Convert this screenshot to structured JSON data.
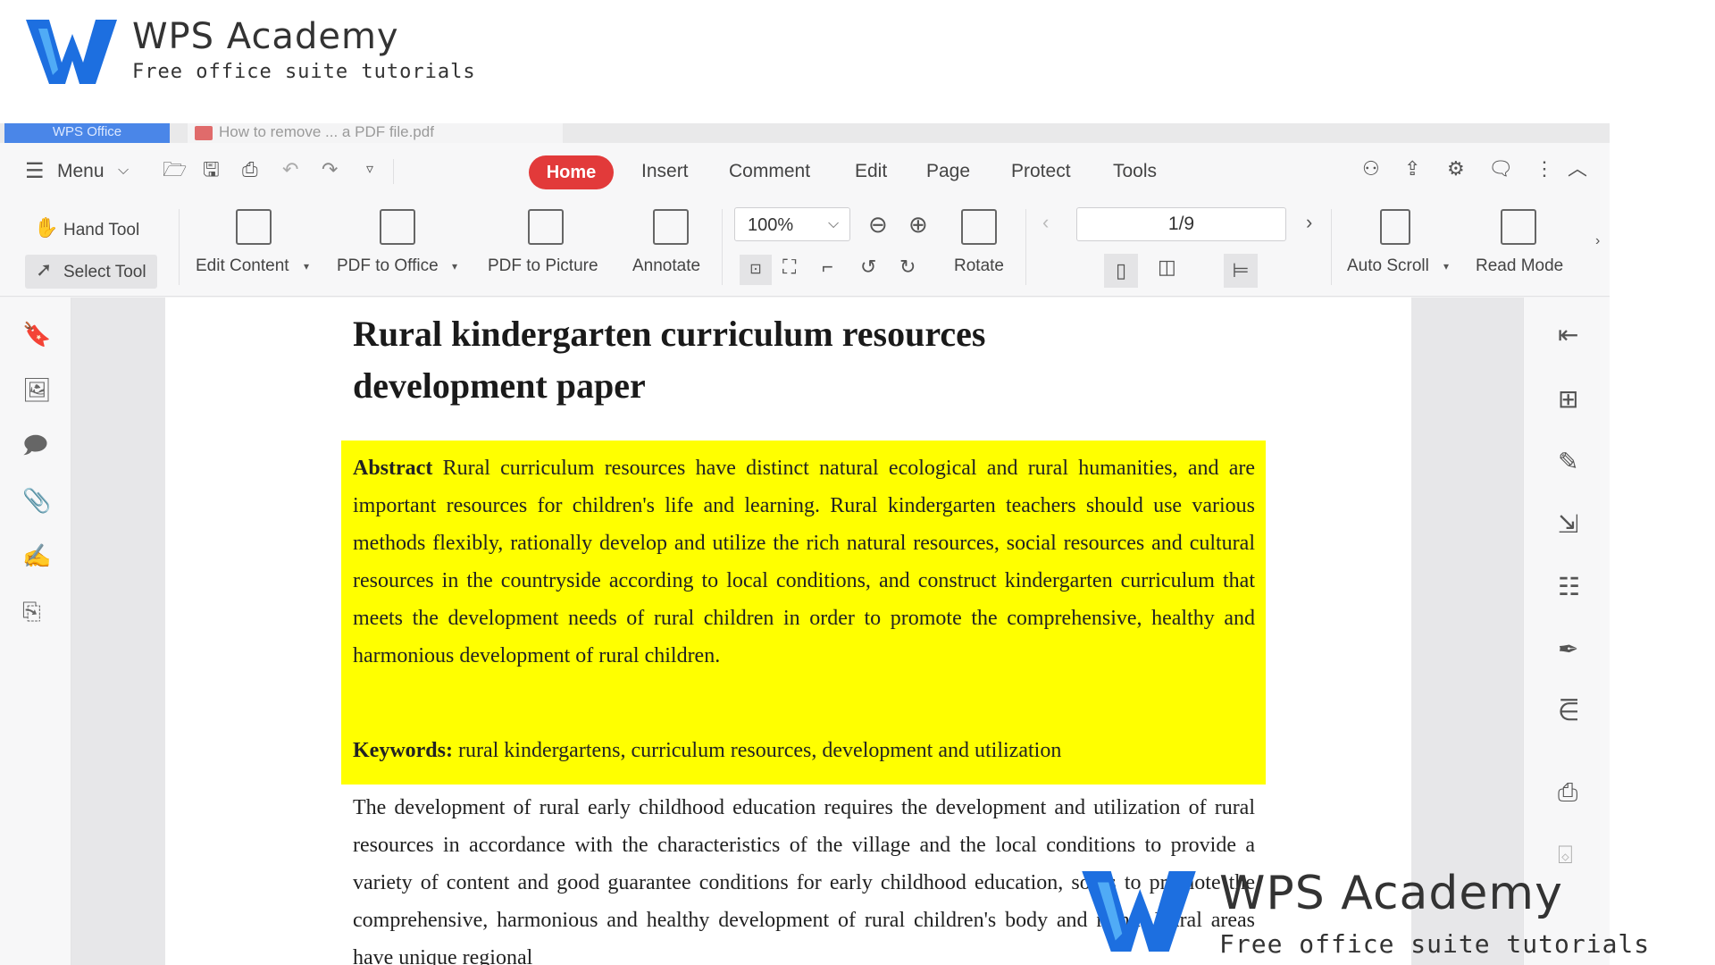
{
  "brand": {
    "title": "WPS Academy",
    "subtitle": "Free office suite tutorials"
  },
  "window": {
    "tabs": [
      {
        "label": "WPS Office"
      },
      {
        "label": "How to remove ... a PDF file.pdf"
      }
    ]
  },
  "menubar": {
    "menu_label": "Menu",
    "tabs": [
      {
        "label": "Home",
        "active": true
      },
      {
        "label": "Insert"
      },
      {
        "label": "Comment"
      },
      {
        "label": "Edit"
      },
      {
        "label": "Page"
      },
      {
        "label": "Protect"
      },
      {
        "label": "Tools"
      }
    ],
    "accent_color": "#e23a3a"
  },
  "ribbon": {
    "hand_tool": "Hand Tool",
    "select_tool": "Select Tool",
    "edit_content": "Edit Content",
    "pdf_to_office": "PDF to Office",
    "pdf_to_picture": "PDF to Picture",
    "annotate": "Annotate",
    "zoom": "100%",
    "rotate": "Rotate",
    "page_indicator": "1/9",
    "auto_scroll": "Auto Scroll",
    "read_mode": "Read Mode"
  },
  "document": {
    "title_line1": "Rural kindergarten curriculum resources",
    "title_line2": "development paper",
    "abstract_label": "Abstract",
    "abstract_text": "Rural curriculum resources have distinct natural ecological and rural humanities, and are important resources for children's life and learning. Rural kindergarten teachers should use various methods flexibly, rationally develop and utilize the rich natural resources, social resources and cultural resources in the countryside according to local conditions, and construct kindergarten curriculum that meets the development needs of rural children in order to promote the comprehensive, healthy and harmonious development of rural children.",
    "keywords_label": "Keywords:",
    "keywords_text": "rural kindergartens, curriculum resources, development and utilization",
    "body_text": "The development of rural early childhood education requires the development and utilization of rural resources in accordance with the characteristics of the village and the local conditions to provide a variety of content and good guarantee conditions for early childhood education, so as to promote the comprehensive, harmonious and healthy development of rural children's body and mind. Rural areas have unique regional",
    "highlight_color": "#ffff00"
  }
}
